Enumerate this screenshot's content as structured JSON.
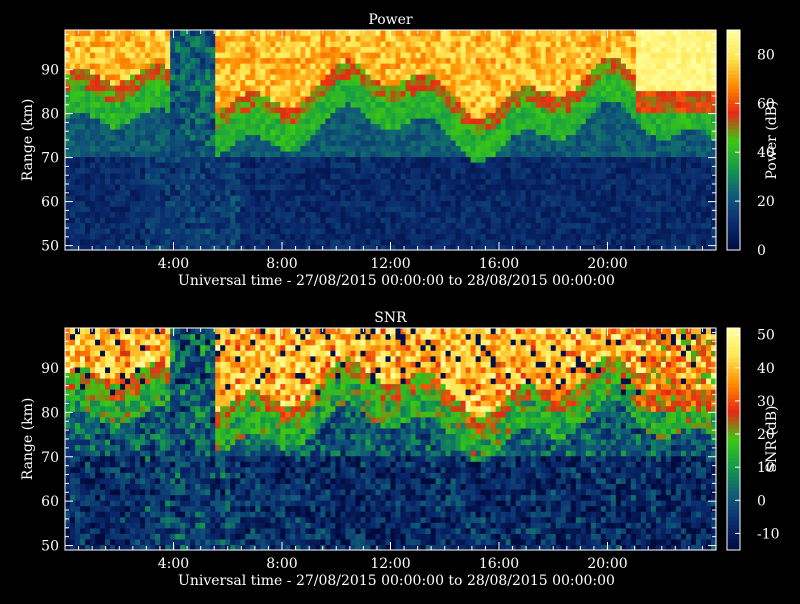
{
  "chart_data": [
    {
      "type": "heatmap",
      "title": "Power",
      "xlabel": "Universal time - 27/08/2015 00:00:00 to 28/08/2015 00:00:00",
      "ylabel": "Range (km)",
      "colorbar_label": "Power (dB)",
      "x_tick_labels": [
        "4:00",
        "8:00",
        "12:00",
        "16:00",
        "20:00"
      ],
      "x_ticks_hours": [
        4,
        8,
        12,
        16,
        20
      ],
      "xlim_hours": [
        0,
        24
      ],
      "y_ticks": [
        50,
        60,
        70,
        80,
        90
      ],
      "ylim": [
        49,
        99
      ],
      "colorbar_ticks": [
        0,
        20,
        40,
        60,
        80
      ],
      "clim": [
        0,
        90
      ],
      "colormap": [
        "#000a3c",
        "#0a2a6e",
        "#105a78",
        "#149a4a",
        "#3cc814",
        "#e62814",
        "#ff8c00",
        "#ffe650",
        "#ffffa0"
      ]
    },
    {
      "type": "heatmap",
      "title": "SNR",
      "xlabel": "Universal time - 27/08/2015 00:00:00 to 28/08/2015 00:00:00",
      "ylabel": "Range (km)",
      "colorbar_label": "SNR (dB)",
      "x_tick_labels": [
        "4:00",
        "8:00",
        "12:00",
        "16:00",
        "20:00"
      ],
      "x_ticks_hours": [
        4,
        8,
        12,
        16,
        20
      ],
      "xlim_hours": [
        0,
        24
      ],
      "y_ticks": [
        50,
        60,
        70,
        80,
        90
      ],
      "ylim": [
        49,
        99
      ],
      "colorbar_ticks": [
        -10,
        0,
        10,
        20,
        30,
        40,
        50
      ],
      "clim": [
        -15,
        52
      ],
      "colormap": [
        "#000a3c",
        "#0a2a6e",
        "#105a78",
        "#149a4a",
        "#3cc814",
        "#e62814",
        "#ff8c00",
        "#ffe650",
        "#ffffa0"
      ]
    }
  ]
}
